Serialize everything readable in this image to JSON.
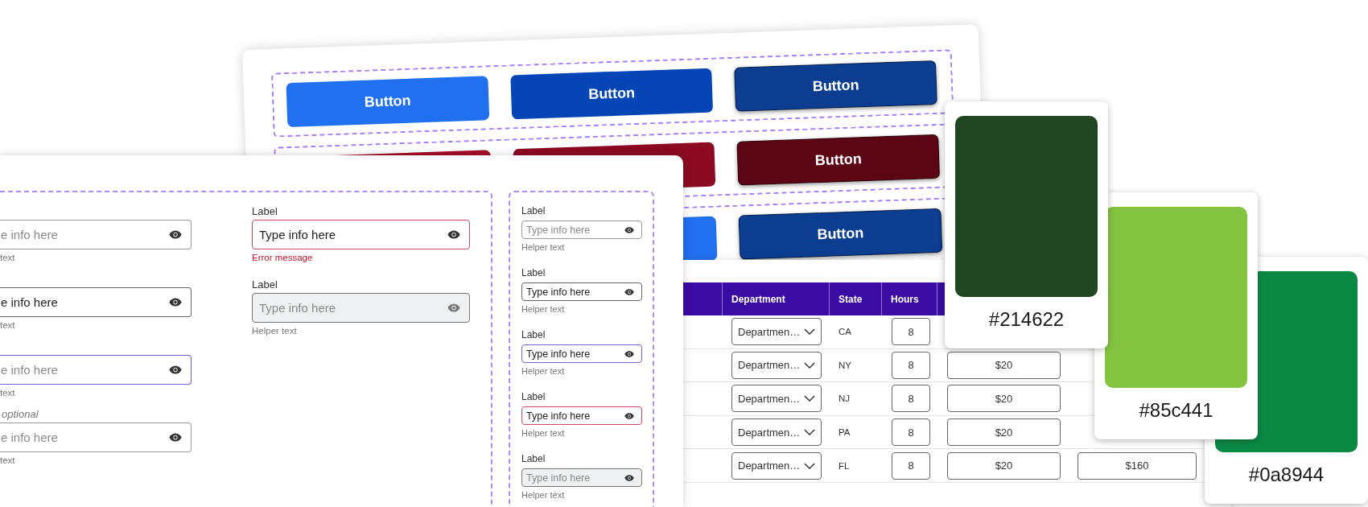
{
  "button_panel": {
    "rows": [
      {
        "buttons": [
          {
            "label": "Button",
            "color": "#2170f0",
            "kind": "flat"
          },
          {
            "label": "Button",
            "color": "#0545b5",
            "kind": "flat"
          },
          {
            "label": "Button",
            "color": "#0b3d91",
            "kind": "raised"
          }
        ]
      },
      {
        "buttons": [
          {
            "color": "#a50d28",
            "kind": "flat"
          },
          {
            "color": "#8c0a22",
            "kind": "flat"
          },
          {
            "label": "Button",
            "color": "#5c0515",
            "kind": "raised"
          }
        ]
      },
      {
        "buttons": [
          {
            "color": "#2170f0",
            "kind": "flat"
          },
          {
            "label": "Button",
            "color": "#0b3d91",
            "kind": "raised"
          }
        ]
      }
    ]
  },
  "form_panel": {
    "groups": [
      {
        "columns": [
          {
            "fields": [
              {
                "placeholder": "e info here",
                "helper": "text",
                "focused": false,
                "error": false,
                "disabled": false
              },
              {
                "value": "e info here",
                "helper": "text",
                "focused": false,
                "error": false,
                "disabled": false
              },
              {
                "placeholder": "e info here",
                "helper": "text",
                "focused": true,
                "error": false,
                "disabled": false
              },
              {
                "optional_note": "optional",
                "placeholder": "e info here",
                "helper": "text",
                "focused": false,
                "error": false,
                "disabled": false
              }
            ]
          },
          {
            "fields": [
              {
                "label": "Label",
                "value": "Type info here",
                "error_message": "Error message",
                "focused": false,
                "error": true,
                "disabled": false
              },
              {
                "label": "Label",
                "placeholder": "Type info here",
                "helper": "Helper text",
                "focused": false,
                "error": false,
                "disabled": true
              }
            ]
          }
        ]
      },
      {
        "columns": [
          {
            "fields": [
              {
                "label": "Label",
                "placeholder": "Type info here",
                "helper": "Helper text",
                "focused": false,
                "error": false,
                "disabled": false
              },
              {
                "label": "Label",
                "value": "Type info here",
                "helper": "Helper text",
                "focused": false,
                "error": false,
                "disabled": false
              },
              {
                "label": "Label",
                "value": "Type info here",
                "helper": "Helper text",
                "focused": true,
                "error": false,
                "disabled": false
              },
              {
                "label": "Label",
                "value": "Type info here",
                "helper": "Helper text",
                "focused": false,
                "error": true,
                "disabled": false
              },
              {
                "label": "Label",
                "placeholder": "Type info here",
                "helper": "Helper text",
                "focused": false,
                "error": false,
                "disabled": true
              }
            ]
          }
        ]
      }
    ]
  },
  "table": {
    "columns": [
      "Department",
      "State",
      "Hours"
    ],
    "rows": [
      {
        "department": "Departmen…",
        "state": "CA",
        "hours": "8"
      },
      {
        "department": "Departmen…",
        "state": "NY",
        "hours": "8",
        "column_5": "$20"
      },
      {
        "department": "Departmen…",
        "state": "NJ",
        "hours": "8",
        "column_5": "$20"
      },
      {
        "department": "Departmen…",
        "state": "PA",
        "hours": "8",
        "column_5": "$20"
      },
      {
        "department": "Departmen…",
        "state": "FL",
        "hours": "8",
        "column_5": "$20",
        "column_6": "$160"
      }
    ]
  },
  "color_cards": [
    {
      "label": "#214622",
      "color": "#214622"
    },
    {
      "label": "#85c441",
      "color": "#85c441"
    },
    {
      "label": "#0a8944",
      "color": "#0a8944"
    }
  ]
}
